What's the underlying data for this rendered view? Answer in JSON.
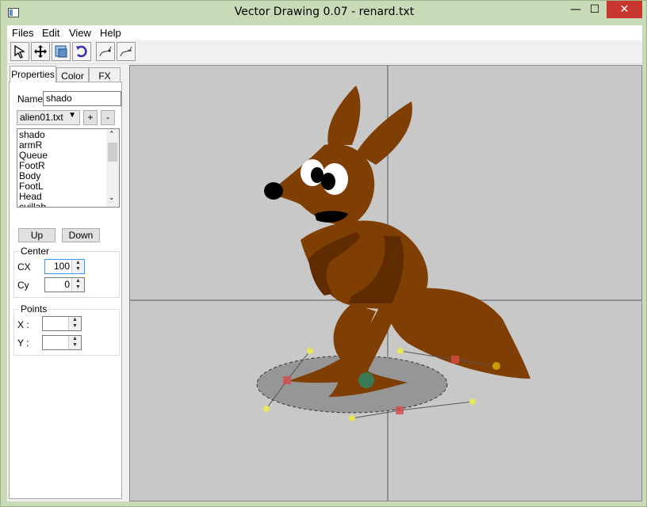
{
  "window": {
    "title": "Vector Drawing 0.07 - renard.txt",
    "minimize": "—",
    "maximize": "☐",
    "close": "✕"
  },
  "menu": {
    "items": [
      "Files",
      "Edit",
      "View",
      "Help"
    ]
  },
  "toolbar": {
    "tools": [
      "select-arrow-icon",
      "move-icon",
      "transform-icon",
      "rotate-icon",
      "add-point-icon",
      "remove-point-icon"
    ]
  },
  "tabs": [
    "Properties",
    "Color",
    "FX"
  ],
  "properties": {
    "name_label": "Name",
    "name_value": "shado",
    "file_select": "alien01.txt",
    "add_label": "+",
    "remove_label": "-",
    "parts": [
      "shado",
      "armR",
      "Queue",
      "FootR",
      "Body",
      "FootL",
      "Head",
      "cuillab"
    ],
    "up_label": "Up",
    "down_label": "Down",
    "center_group": "Center",
    "cx_label": "CX",
    "cx_value": "100",
    "cy_label": "Cy",
    "cy_value": "0",
    "points_group": "Points",
    "x_label": "X :",
    "x_value": "",
    "y_label": "Y :",
    "y_value": ""
  },
  "colors": {
    "fox_body": "#7f3e02",
    "fox_dark": "#5e2c00",
    "shadow": "#969696",
    "selection_handle": "#d94a4a",
    "control_point": "#e6e65a",
    "center_point": "#3a7a55",
    "canvas_bg": "#c8c8c8",
    "title_bar": "#c9dab6"
  }
}
